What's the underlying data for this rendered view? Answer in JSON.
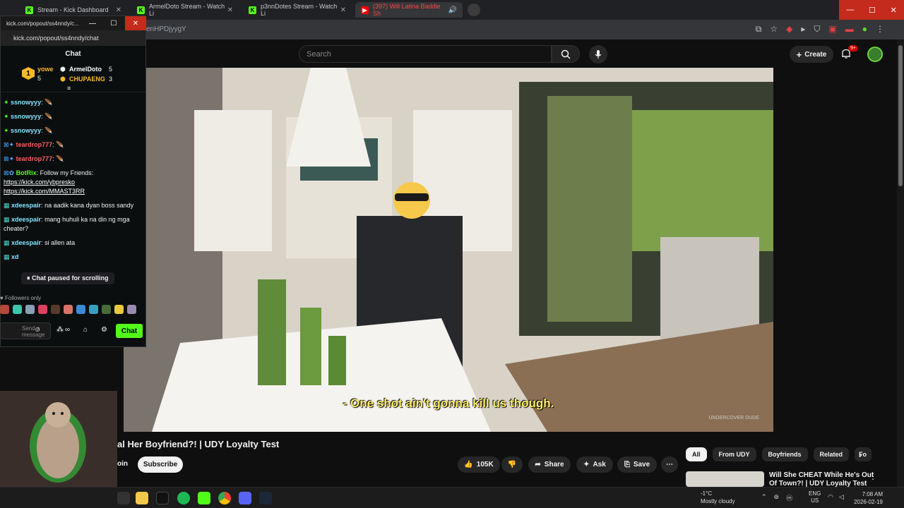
{
  "browser": {
    "tabs": [
      {
        "title": "Stream - Kick Dashboard",
        "icon": "kick-icon"
      },
      {
        "title": "ArmelDoto Stream - Watch Li",
        "icon": "kick-icon"
      },
      {
        "title": "p3nnDotes Stream - Watch Li",
        "icon": "kick-icon"
      },
      {
        "title": "(397) Will Latina Baddie Sh",
        "icon": "youtube-icon"
      }
    ],
    "url_fragment": "enHPDjyygY"
  },
  "youtube": {
    "search_placeholder": "Search",
    "create_label": "Create",
    "notif_badge": "9+",
    "subtitle": "- One shot ain't gonna kill us though.",
    "watermark": "UNDERCOVER DUDE",
    "video_title": "al Her Boyfriend?! | UDY Loyalty Test",
    "join_label": "oin",
    "subscribe_label": "Subscribe",
    "like_count": "105K",
    "share_label": "Share",
    "ask_label": "Ask",
    "save_label": "Save",
    "chips": [
      "All",
      "From UDY",
      "Boyfriends",
      "Related",
      "Fo"
    ],
    "related_title": "Will She CHEAT While He's Out Of Town?! | UDY Loyalty Test"
  },
  "kick": {
    "window_title": "kick.com/popout/ss4nndy/c...",
    "url": "kick.com/popout/ss4nndy/chat",
    "chat_header": "Chat",
    "leaderboard": [
      {
        "rank": "1",
        "name": "yowe",
        "count": "5",
        "color": "#f7b928"
      },
      {
        "name": "ArmelDoto",
        "count": "5",
        "color": "#ffffff"
      },
      {
        "name": "CHUPAENG",
        "count": "3",
        "color": "#f7b928"
      }
    ],
    "messages": [
      {
        "user": "ssnowyyy",
        "text": "",
        "color": "#86e3ff"
      },
      {
        "user": "ssnowyyy",
        "text": "",
        "color": "#86e3ff"
      },
      {
        "user": "ssnowyyy",
        "text": "",
        "color": "#86e3ff"
      },
      {
        "user": "teardrop777",
        "text": "",
        "color": "#ff5d5d"
      },
      {
        "user": "teardrop777",
        "text": "",
        "color": "#ff5d5d"
      },
      {
        "user": "BotRix",
        "text": "Follow my Friends:",
        "links": [
          "https://kick.com/ybpresko",
          "https://kick.com/MMAST3RR"
        ],
        "color": "#53fc18"
      },
      {
        "user": "xdeespair",
        "text": "na aadik kana dyan boss sandy",
        "color": "#86e3ff"
      },
      {
        "user": "xdeespair",
        "text": "mang huhuli ka na din ng mga cheater?",
        "color": "#86e3ff"
      },
      {
        "user": "xdeespair",
        "text": "si allen ata",
        "color": "#86e3ff"
      },
      {
        "user": "xd",
        "text": "",
        "color": "#86e3ff"
      }
    ],
    "paused_label": "Chat paused for scrolling",
    "followers_only": "Followers only",
    "input_placeholder": "Send a message",
    "chat_button": "Chat"
  },
  "taskbar": {
    "weather_temp": "-1°C",
    "weather_desc": "Mostly cloudy",
    "lang_1": "ENG",
    "lang_2": "US",
    "time": "7:08 AM",
    "date": "2026-02-19"
  }
}
